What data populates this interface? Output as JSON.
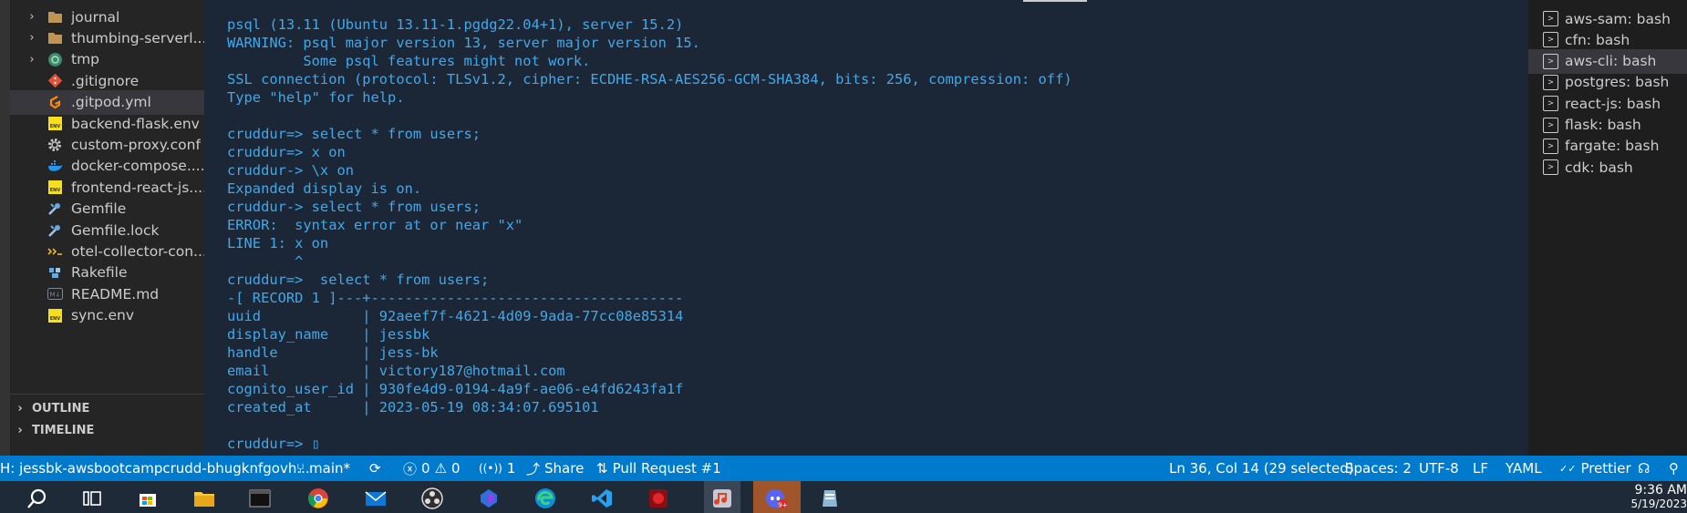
{
  "explorer": {
    "files": [
      {
        "name": "journal",
        "icon": "folder-icon",
        "chevron": "›",
        "kind": "folder"
      },
      {
        "name": "thumbing-serverl...",
        "icon": "folder-icon",
        "chevron": "›",
        "kind": "folder"
      },
      {
        "name": "tmp",
        "icon": "folder-special-icon",
        "chevron": "›",
        "kind": "folder-special"
      },
      {
        "name": ".gitignore",
        "icon": "git-icon",
        "chevron": "",
        "kind": "git"
      },
      {
        "name": ".gitpod.yml",
        "icon": "gitpod-icon",
        "chevron": "",
        "kind": "gitpod"
      },
      {
        "name": "backend-flask.env",
        "icon": "env-file-icon",
        "chevron": "",
        "kind": "env"
      },
      {
        "name": "custom-proxy.conf",
        "icon": "gear-icon",
        "chevron": "",
        "kind": "gear"
      },
      {
        "name": "docker-compose....",
        "icon": "docker-icon",
        "chevron": "",
        "kind": "docker"
      },
      {
        "name": "frontend-react-js....",
        "icon": "env-file-icon",
        "chevron": "",
        "kind": "env"
      },
      {
        "name": "Gemfile",
        "icon": "ruby-gem-icon",
        "chevron": "",
        "kind": "gem"
      },
      {
        "name": "Gemfile.lock",
        "icon": "ruby-gem-icon",
        "chevron": "",
        "kind": "gem"
      },
      {
        "name": "otel-collector-con...",
        "icon": "yaml-icon",
        "chevron": "",
        "kind": "yaml"
      },
      {
        "name": "Rakefile",
        "icon": "rake-icon",
        "chevron": "",
        "kind": "rake"
      },
      {
        "name": "README.md",
        "icon": "markdown-icon",
        "chevron": "",
        "kind": "md"
      },
      {
        "name": "sync.env",
        "icon": "env-file-icon",
        "chevron": "",
        "kind": "env"
      }
    ],
    "sections": [
      {
        "label": "OUTLINE",
        "chevron": "›"
      },
      {
        "label": "TIMELINE",
        "chevron": "›"
      }
    ],
    "env_badge": "ENV",
    "md_badge": "M↓"
  },
  "terminal": {
    "lines": [
      "psql (13.11 (Ubuntu 13.11-1.pgdg22.04+1), server 15.2)",
      "WARNING: psql major version 13, server major version 15.",
      "         Some psql features might not work.",
      "SSL connection (protocol: TLSv1.2, cipher: ECDHE-RSA-AES256-GCM-SHA384, bits: 256, compression: off)",
      "Type \"help\" for help.",
      "",
      "cruddur=> select * from users;",
      "cruddur=> x on",
      "cruddur-> \\x on",
      "Expanded display is on.",
      "cruddur-> select * from users;",
      "ERROR:  syntax error at or near \"x\"",
      "LINE 1: x on",
      "        ^",
      "cruddur=>  select * from users;",
      "-[ RECORD 1 ]---+-------------------------------------",
      "uuid            | 92aeef7f-4621-4d09-9ada-77cc08e85314",
      "display_name    | jessbk",
      "handle          | jess-bk",
      "email           | victory187@hotmail.com",
      "cognito_user_id | 930fe4d9-0194-4a9f-ae06-e4fd6243fa1f",
      "created_at      | 2023-05-19 08:34:07.695101",
      "",
      "cruddur=> "
    ],
    "cursor": "▯",
    "text_color": "#44a7e8",
    "background": "#1b2736"
  },
  "terminal_list": {
    "items": [
      {
        "label": "aws-sam: bash",
        "icon": "terminal-icon",
        "glyph": ">"
      },
      {
        "label": "cfn: bash",
        "icon": "terminal-icon",
        "glyph": ">"
      },
      {
        "label": "aws-cli: bash",
        "icon": "terminal-icon",
        "glyph": ">"
      },
      {
        "label": "postgres: bash",
        "icon": "terminal-icon",
        "glyph": ">"
      },
      {
        "label": "react-js: bash",
        "icon": "terminal-icon",
        "glyph": ">"
      },
      {
        "label": "flask: bash",
        "icon": "terminal-icon",
        "glyph": ">"
      },
      {
        "label": "fargate: bash",
        "icon": "terminal-icon",
        "glyph": ">"
      },
      {
        "label": "cdk: bash",
        "icon": "terminal-icon",
        "glyph": ">"
      }
    ],
    "active_index": 2
  },
  "statusbar": {
    "remote": "H: jessbk-awsbootcampcrudd-bhugknfgovh...",
    "branch": "main*",
    "branch_icon": "⑂",
    "sync_icon": "⟳",
    "errors": "0",
    "warnings": "0",
    "error_icon": "ⓧ",
    "warning_icon": "⚠",
    "ports": "1",
    "ports_icon": "📡",
    "share": "Share",
    "share_icon": "⤴",
    "pull_request": "Pull Request #1",
    "pr_icon": "⇅",
    "cursor_position": "Ln 36, Col 14 (29 selected)",
    "spaces": "Spaces: 2",
    "encoding": "UTF-8",
    "eol": "LF",
    "language": "YAML",
    "prettier": "Prettier",
    "prettier_icon": "✓✓",
    "feedback_icon": "☊",
    "bell_icon": "⚲",
    "color": "#007acc"
  },
  "taskbar": {
    "time": "9:36 AM",
    "date": "5/19/2023",
    "badge": "9+",
    "icons": [
      "search-icon",
      "task-view-icon",
      "store-icon",
      "file-explorer-icon",
      "terminal-app-icon",
      "chrome-icon",
      "mail-icon",
      "obs-icon",
      "bing-icon",
      "edge-icon",
      "vscode-icon",
      "red-app-icon",
      "music-app-icon",
      "discord-icon",
      "notepad-icon"
    ]
  }
}
